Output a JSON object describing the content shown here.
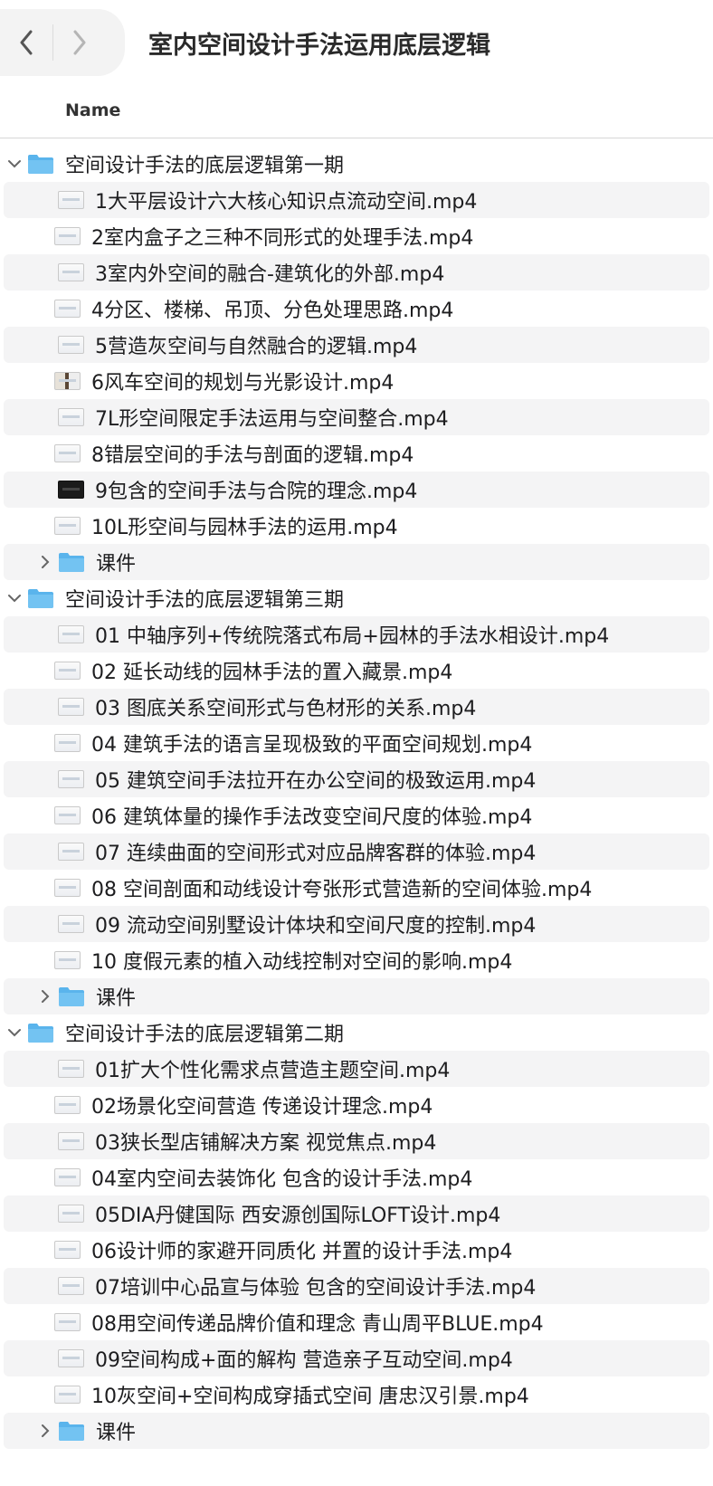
{
  "window": {
    "title": "室内空间设计手法运用底层逻辑",
    "column_name": "Name"
  },
  "groups": [
    {
      "label": "空间设计手法的底层逻辑第一期",
      "files": [
        "1大平层设计六大核心知识点流动空间.mp4",
        "2室内盒子之三种不同形式的处理手法.mp4",
        "3室内外空间的融合-建筑化的外部.mp4",
        "4分区、楼梯、吊顶、分色处理思路.mp4",
        "5营造灰空间与自然融合的逻辑.mp4",
        "6风车空间的规划与光影设计.mp4",
        "7L形空间限定手法运用与空间整合.mp4",
        "8错层空间的手法与剖面的逻辑.mp4",
        "9包含的空间手法与合院的理念.mp4",
        "10L形空间与园林手法的运用.mp4"
      ],
      "subfolder": "课件"
    },
    {
      "label": "空间设计手法的底层逻辑第三期",
      "files": [
        "01 中轴序列+传统院落式布局+园林的手法水相设计.mp4",
        "02 延长动线的园林手法的置入藏景.mp4",
        "03 图底关系空间形式与色材形的关系.mp4",
        "04 建筑手法的语言呈现极致的平面空间规划.mp4",
        "05 建筑空间手法拉开在办公空间的极致运用.mp4",
        "06 建筑体量的操作手法改变空间尺度的体验.mp4",
        "07 连续曲面的空间形式对应品牌客群的体验.mp4",
        "08 空间剖面和动线设计夸张形式营造新的空间体验.mp4",
        "09 流动空间别墅设计体块和空间尺度的控制.mp4",
        "10 度假元素的植入动线控制对空间的影响.mp4"
      ],
      "subfolder": "课件"
    },
    {
      "label": "空间设计手法的底层逻辑第二期",
      "files": [
        "01扩大个性化需求点营造主题空间.mp4",
        "02场景化空间营造  传递设计理念.mp4",
        "03狭长型店铺解决方案  视觉焦点.mp4",
        "04室内空间去装饰化  包含的设计手法.mp4",
        "05DIA丹健国际  西安源创国际LOFT设计.mp4",
        "06设计师的家避开同质化  并置的设计手法.mp4",
        "07培训中心品宣与体验  包含的空间设计手法.mp4",
        "08用空间传递品牌价值和理念  青山周平BLUE.mp4",
        "09空间构成+面的解构  营造亲子互动空间.mp4",
        "10灰空间+空间构成穿插式空间  唐忠汉引景.mp4"
      ],
      "subfolder": "课件"
    }
  ],
  "colors": {
    "folder_blue": "#5ab4ec",
    "row_alt": "#f4f4f5"
  }
}
